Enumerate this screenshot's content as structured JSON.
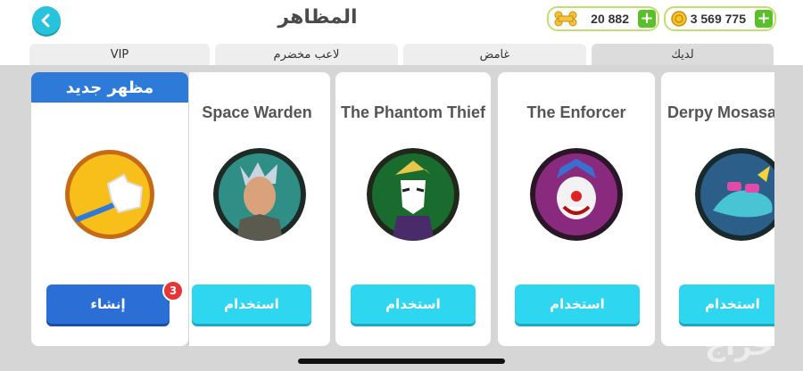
{
  "header": {
    "title": "المظاهر",
    "coins_value": "3 569 775",
    "bones_value": "20 882",
    "plus_symbol": "+"
  },
  "tabs": [
    {
      "label": "لديك",
      "active": true
    },
    {
      "label": "غامض",
      "active": false
    },
    {
      "label": "لاعب مخضرم",
      "active": false
    },
    {
      "label": "VIP",
      "active": false
    }
  ],
  "new_card": {
    "header": "مظهر جديد",
    "button_label": "إنشاء",
    "badge_count": "3"
  },
  "skins": [
    {
      "name": "Space Warden",
      "button_label": "استخدام"
    },
    {
      "name": "The Phantom Thief",
      "button_label": "استخدام"
    },
    {
      "name": "The Enforcer",
      "button_label": "استخدام"
    },
    {
      "name": "Derpy Mosasaur",
      "button_label": "استخدام"
    }
  ],
  "watermark": "حراج",
  "colors": {
    "accent": "#2fd6ef",
    "create": "#2b6fd6",
    "currency_border": "#bfe16b",
    "plus": "#59c02a"
  }
}
